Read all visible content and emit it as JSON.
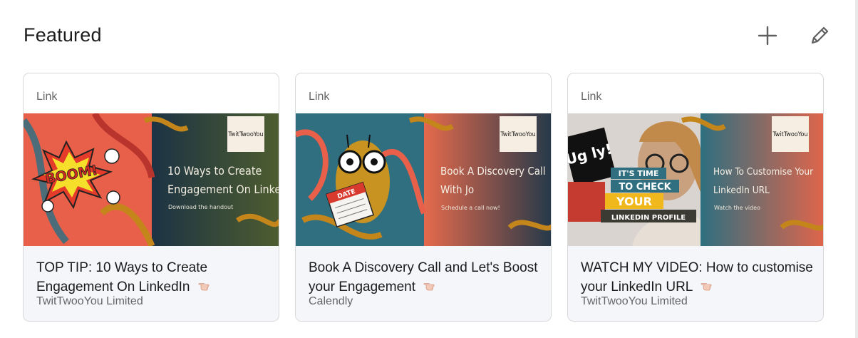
{
  "section": {
    "title": "Featured",
    "add_label": "+",
    "edit_label": "Edit"
  },
  "cards": [
    {
      "kind": "Link",
      "headline": "TOP TIP: 10 Ways to Create Engagement On LinkedIn",
      "source": "TwitTwooYou Limited",
      "thumb_title_1": "10 Ways to Create",
      "thumb_title_2": "Engagement On LinkedIn",
      "thumb_sub": "Download the handout",
      "thumb_logo": "TwitTwooYou",
      "thumb_burst": "BOOM!"
    },
    {
      "kind": "Link",
      "headline": "Book A Discovery Call and Let's Boost your Engagement",
      "source": "Calendly",
      "thumb_title_1": "Book A Discovery Call",
      "thumb_title_2": "With Jo",
      "thumb_sub": "Schedule a call now!",
      "thumb_logo": "TwitTwooYou",
      "thumb_calendar": "DATE"
    },
    {
      "kind": "Link",
      "headline": "WATCH MY VIDEO: How to customise your LinkedIn URL",
      "source": "TwitTwooYou Limited",
      "thumb_title_1": "How To Customise Your",
      "thumb_title_2": "LinkedIn URL",
      "thumb_sub": "Watch the video",
      "thumb_logo": "TwitTwooYou",
      "thumb_ugly": "Ug ly!",
      "thumb_line_1": "IT'S TIME",
      "thumb_line_2": "TO CHECK",
      "thumb_line_3": "YOUR",
      "thumb_line_4": "LINKEDIN PROFILE"
    }
  ],
  "colors": {
    "coral": "#e8604a",
    "teal_dark": "#213b47",
    "olive": "#4d5a32",
    "gold": "#c4861a",
    "meta_bg": "#f4f6fa"
  }
}
